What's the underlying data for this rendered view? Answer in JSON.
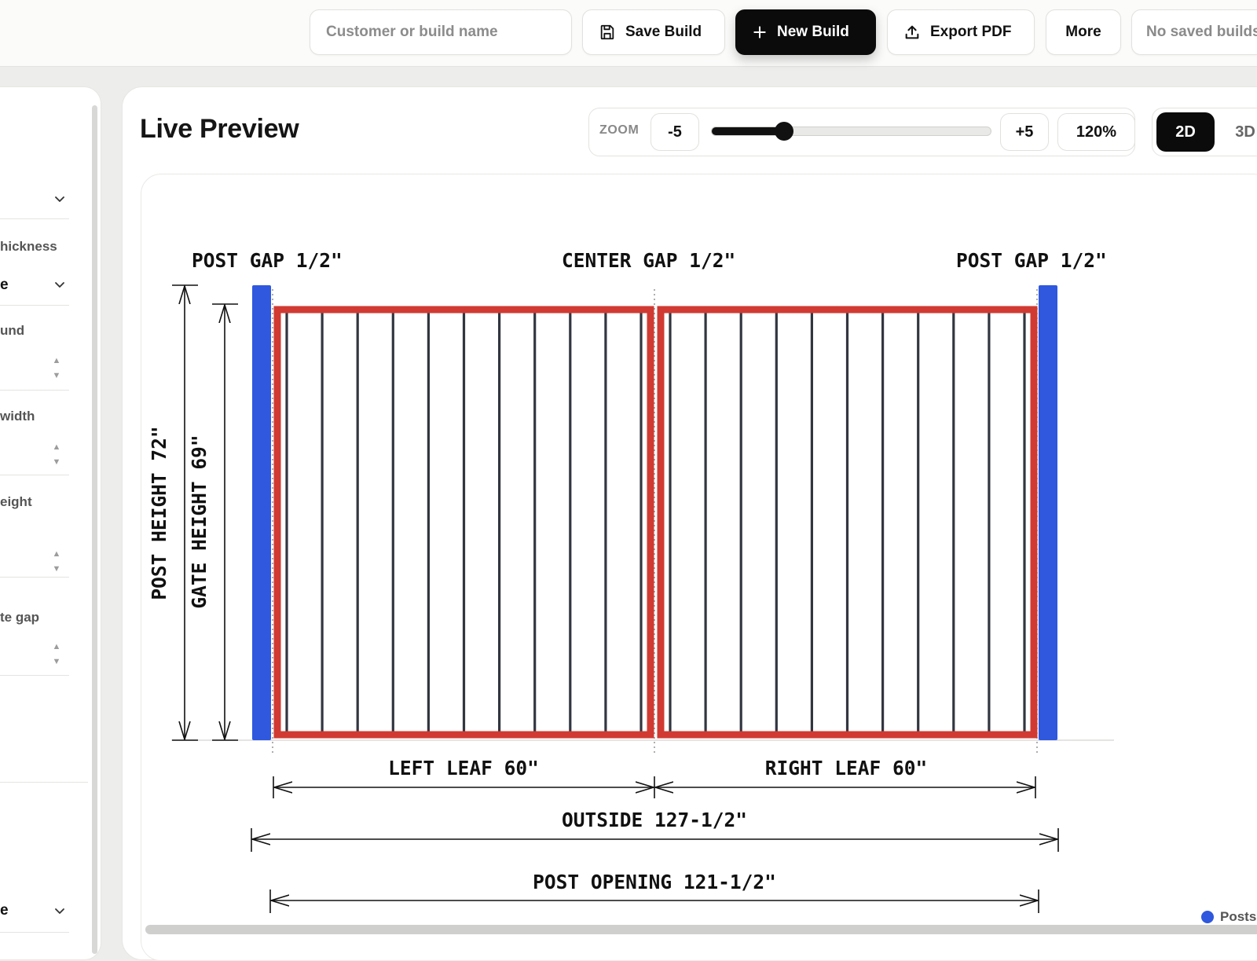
{
  "toolbar": {
    "search_placeholder": "Customer or build name",
    "save_label": "Save Build",
    "new_label": "New Build",
    "export_label": "Export PDF",
    "more_label": "More",
    "saved_status": "No saved builds"
  },
  "sidebar": {
    "items": [
      {
        "label": "",
        "value": "",
        "control": "select"
      },
      {
        "label": "hickness",
        "value": "e",
        "control": "select"
      },
      {
        "label": "und",
        "value": "",
        "control": "number"
      },
      {
        "label": "width",
        "value": "",
        "control": "number"
      },
      {
        "label": "eight",
        "value": "",
        "control": "number"
      },
      {
        "label": "te gap",
        "value": "",
        "control": "number"
      },
      {
        "label": "",
        "value": "e",
        "control": "select"
      }
    ]
  },
  "preview": {
    "title": "Live Preview",
    "zoom_label": "ZOOM",
    "zoom_minus": "-5",
    "zoom_plus": "+5",
    "zoom_percent": "120%",
    "zoom_slider_fraction": 0.26,
    "view_2d": "2D",
    "view_3d": "3D",
    "active_view": "2D"
  },
  "drawing": {
    "post_gap_left": "POST GAP 1/2\"",
    "center_gap": "CENTER GAP 1/2\"",
    "post_gap_right": "POST GAP 1/2\"",
    "post_height": "POST HEIGHT 72\"",
    "gate_height": "GATE HEIGHT 69\"",
    "left_leaf": "LEFT LEAF 60\"",
    "right_leaf": "RIGHT LEAF 60\"",
    "outside": "OUTSIDE 127-1/2\"",
    "post_opening": "POST OPENING 121-1/2\"",
    "pickets_per_leaf": 10,
    "colors": {
      "post": "#2f58de",
      "frame": "#d03a32",
      "picket": "#323640"
    }
  },
  "legend": {
    "posts_label": "Posts"
  }
}
